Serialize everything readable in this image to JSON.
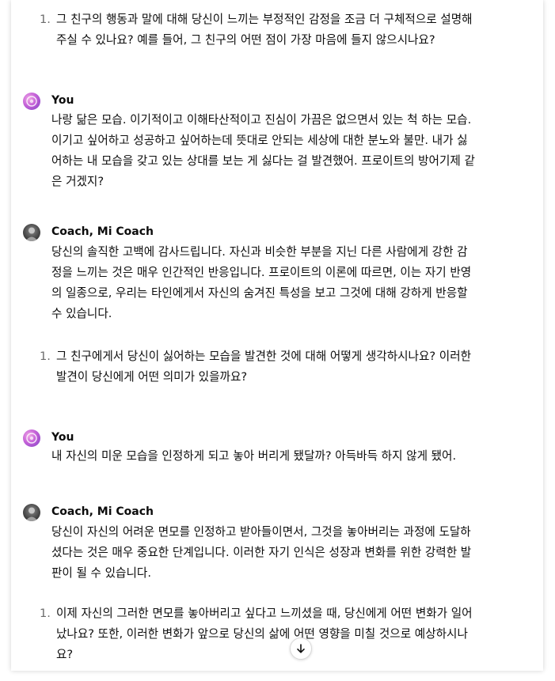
{
  "messages": [
    {
      "list": {
        "number": "1.",
        "lines": [
          "그 친구의 행동과 말에 대해 당신이 느끼는 부정적인 감정을 조금 더 구체적으로 설명해",
          "주실 수 있나요? 예를 들어, 그 친구의 어떤 점이 가장 마음에 들지 않으시나요?"
        ]
      }
    },
    {
      "author": "You",
      "avatar": "user-avatar-icon",
      "lines": [
        "나랑 닮은 모습. 이기적이고 이해타산적이고 진심이 가끔은 없으면서 있는 척 하는 모습.",
        "이기고 싶어하고 성공하고 싶어하는데 뜻대로 안되는 세상에 대한 분노와 불만. 내가 싫",
        "어하는 내 모습을 갖고 있는 상대를 보는 게 싫다는 걸 발견했어. 프로이트의 방어기제 같",
        "은 거겠지?"
      ]
    },
    {
      "author": "Coach, Mi Coach",
      "avatar": "coach-avatar-icon",
      "lines": [
        "당신의 솔직한 고백에 감사드립니다. 자신과 비슷한 부분을 지닌 다른 사람에게 강한 감",
        "정을 느끼는 것은 매우 인간적인 반응입니다. 프로이트의 이론에 따르면, 이는 자기 반영",
        "의 일종으로, 우리는 타인에게서 자신의 숨겨진 특성을 보고 그것에 대해 강하게 반응할",
        "수 있습니다."
      ],
      "list": {
        "number": "1.",
        "lines": [
          "그 친구에게서 당신이 싫어하는 모습을 발견한 것에 대해 어떻게 생각하시나요? 이러한",
          "발견이 당신에게 어떤 의미가 있을까요?"
        ]
      }
    },
    {
      "author": "You",
      "avatar": "user-avatar-icon",
      "lines": [
        "내 자신의 미운 모습을 인정하게 되고 놓아 버리게 됐달까? 아득바득 하지 않게 됐어."
      ]
    },
    {
      "author": "Coach, Mi Coach",
      "avatar": "coach-avatar-icon",
      "lines": [
        "당신이 자신의 어려운 면모를 인정하고 받아들이면서, 그것을 놓아버리는 과정에 도달하",
        "셨다는 것은 매우 중요한 단계입니다. 이러한 자기 인식은 성장과 변화를 위한 강력한 발",
        "판이 될 수 있습니다."
      ],
      "list": {
        "number": "1.",
        "lines": [
          "이제 자신의 그러한 면모를 놓아버리고 싶다고 느끼셨을 때, 당신에게 어떤 변화가 일어",
          "났나요? 또한, 이러한 변화가 앞으로 당신의 삶에 어떤 영향을 미칠 것으로 예상하시나",
          "요?"
        ]
      }
    }
  ],
  "scroll_button": {
    "icon": "arrow-down-icon"
  }
}
